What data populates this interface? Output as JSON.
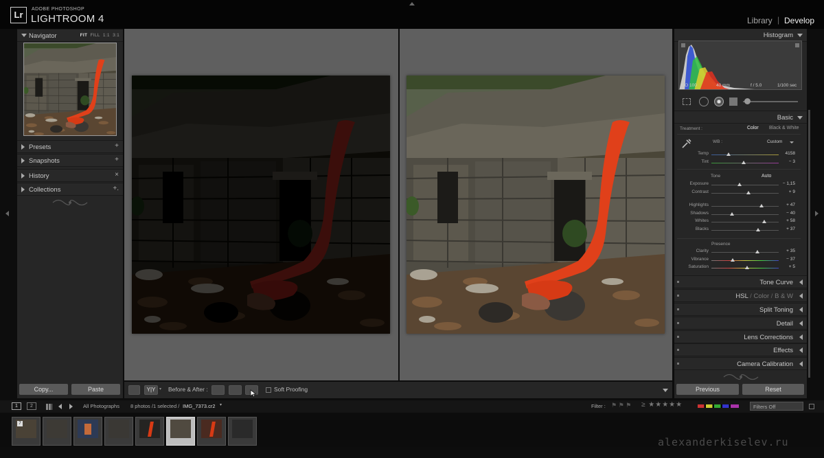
{
  "app": {
    "badge": "Lr",
    "vendor": "ADOBE PHOTOSHOP",
    "title": "LIGHTROOM 4",
    "modules": [
      "Library",
      "Develop"
    ],
    "active_module": "Develop",
    "separator": "|"
  },
  "navigator": {
    "label": "Navigator",
    "zoom_options": [
      "FIT",
      "FILL",
      "1:1",
      "3:1"
    ],
    "active_zoom": "FIT"
  },
  "left_panels": [
    {
      "label": "Presets",
      "action": "+"
    },
    {
      "label": "Snapshots",
      "action": "+"
    },
    {
      "label": "History",
      "action": "×"
    },
    {
      "label": "Collections",
      "action": "+."
    }
  ],
  "left_buttons": {
    "copy": "Copy...",
    "paste": "Paste"
  },
  "toolbar": {
    "view_mode": "Y|Y",
    "before_after_label": "Before & After :",
    "soft_proofing": "Soft Proofing"
  },
  "histogram": {
    "label": "Histogram",
    "iso": "ISO 100",
    "focal": "40 mm",
    "aperture": "f / 5.0",
    "shutter": "1/100 sec"
  },
  "basic": {
    "label": "Basic",
    "treatment_label": "Treatment :",
    "treatment_color": "Color",
    "treatment_bw": "Black & White",
    "wb_label": "WB :",
    "wb_value": "Custom",
    "tone_label": "Tone",
    "auto_label": "Auto",
    "presence_label": "Presence",
    "wb_sliders": [
      {
        "label": "Temp",
        "value": "4158",
        "pos": 0.25
      },
      {
        "label": "Tint",
        "value": "− 3",
        "pos": 0.48
      }
    ],
    "tone_sliders": [
      {
        "label": "Exposure",
        "value": "− 1,15",
        "pos": 0.42
      },
      {
        "label": "Contrast",
        "value": "+ 9",
        "pos": 0.55
      }
    ],
    "tone_sliders2": [
      {
        "label": "Highlights",
        "value": "+ 47",
        "pos": 0.74
      },
      {
        "label": "Shadows",
        "value": "− 40",
        "pos": 0.31
      },
      {
        "label": "Whites",
        "value": "+ 58",
        "pos": 0.79
      },
      {
        "label": "Blacks",
        "value": "+ 37",
        "pos": 0.69
      }
    ],
    "presence_sliders": [
      {
        "label": "Clarity",
        "value": "+ 35",
        "pos": 0.68
      },
      {
        "label": "Vibrance",
        "value": "− 37",
        "pos": 0.32
      },
      {
        "label": "Saturation",
        "value": "+ 5",
        "pos": 0.53
      }
    ]
  },
  "right_panels": [
    "Tone Curve",
    "HSL / Color / B & W",
    "Split Toning",
    "Detail",
    "Lens Corrections",
    "Effects",
    "Camera Calibration"
  ],
  "hsl_parts": [
    "HSL",
    "/",
    "Color",
    "/",
    "B & W"
  ],
  "right_buttons": {
    "previous": "Previous",
    "reset": "Reset"
  },
  "filmstrip": {
    "page1": "1",
    "page2": "2",
    "source": "All Photographs",
    "info_count": "8 photos /1 selected /",
    "filename": "IMG_7373.cr2",
    "filter_label": "Filter :",
    "filters_off": "Filters Off",
    "thumbnail_count": 8,
    "selected_index": 5,
    "thumb_badge": "7"
  },
  "watermark": "alexanderkiselev.ru",
  "colors": {
    "accent_red": "#e0401a",
    "panel": "#262626",
    "canvas": "#5f5f5f"
  }
}
